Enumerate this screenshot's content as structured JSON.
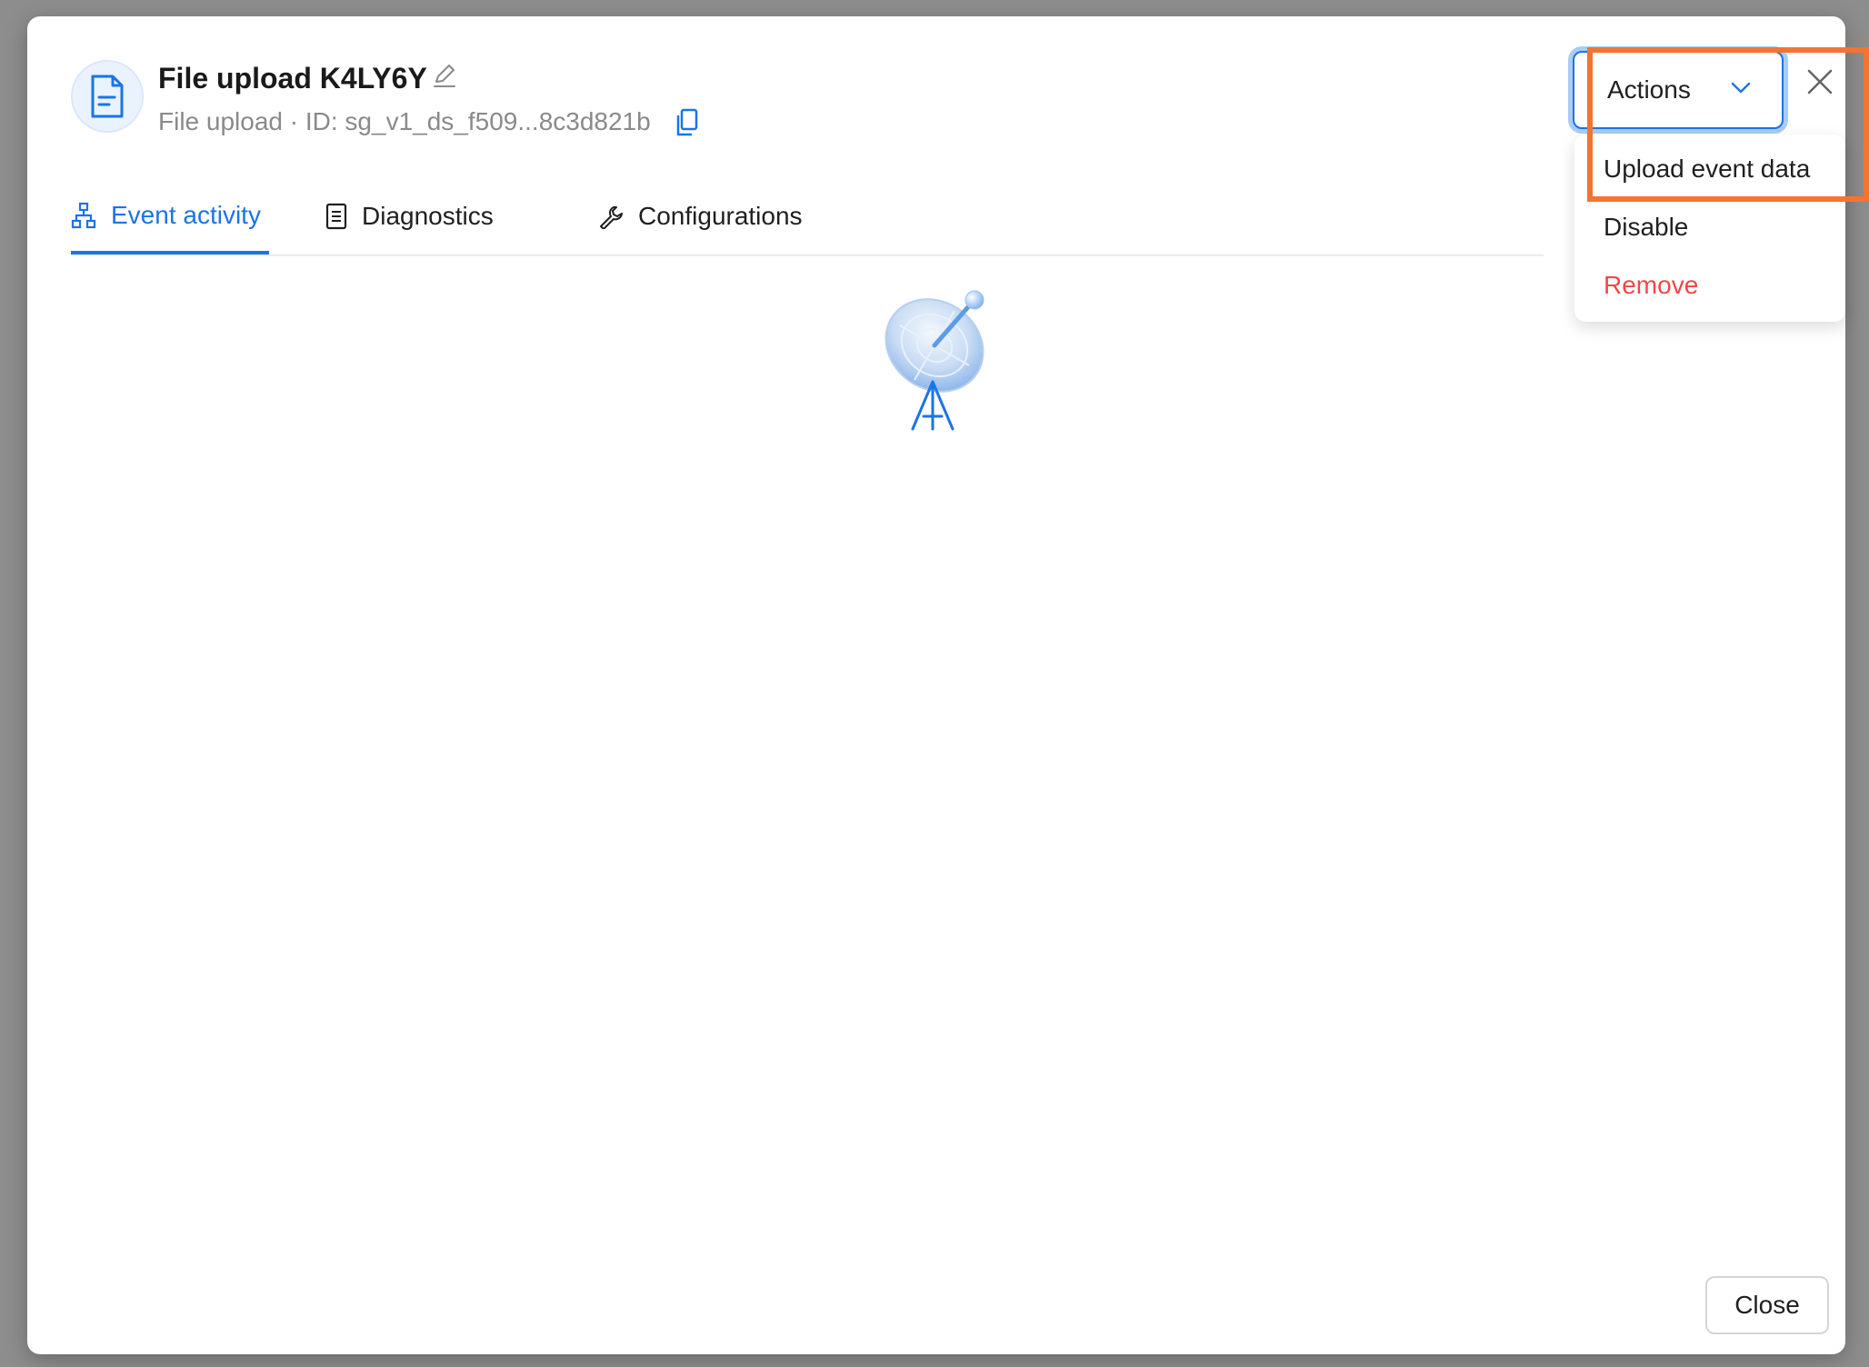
{
  "modal": {
    "title": "File upload K4LY6Y",
    "subtitle": "File upload · ID: sg_v1_ds_f509...8c3d821b"
  },
  "tabs": [
    {
      "label": "Event activity",
      "active": true
    },
    {
      "label": "Diagnostics",
      "active": false
    },
    {
      "label": "Configurations",
      "active": false
    }
  ],
  "actions": {
    "label": "Actions",
    "menu": [
      {
        "label": "Upload event data"
      },
      {
        "label": "Disable"
      },
      {
        "label": "Remove",
        "color": "#f04848"
      }
    ]
  },
  "footer": {
    "close_label": "Close"
  },
  "colors": {
    "accent": "#1b74e4",
    "danger": "#f04848",
    "highlight": "#f47431"
  },
  "icons": {
    "header": "document-icon",
    "edit": "pencil-icon",
    "copy": "copy-icon",
    "tab_event": "hierarchy-icon",
    "tab_diag": "clipboard-icon",
    "tab_config": "wrench-icon",
    "empty_state": "satellite-dish-icon",
    "close": "close-icon",
    "chevron": "chevron-down-icon"
  }
}
